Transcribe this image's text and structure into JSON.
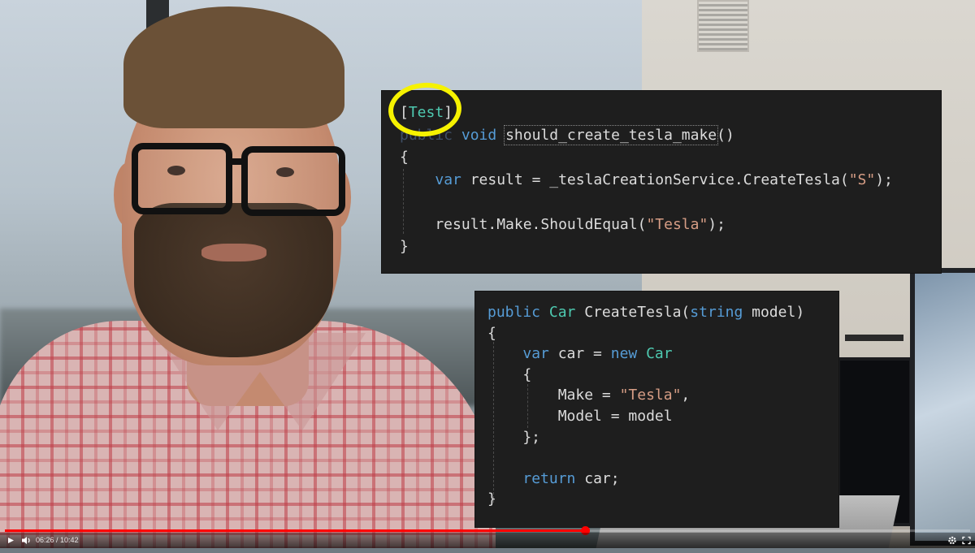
{
  "player": {
    "time_current": "06:26",
    "time_separator": " / ",
    "time_total": "10:42",
    "progress_fraction": 0.601,
    "accent_color": "#ff0000",
    "icons": {
      "play": "play-icon",
      "volume": "volume-icon",
      "settings": "gear-icon",
      "fullscreen": "fullscreen-icon"
    }
  },
  "code_top": {
    "lines": [
      {
        "segments": [
          {
            "t": "[",
            "c": "pl"
          },
          {
            "t": "Test",
            "c": "ty"
          },
          {
            "t": "]",
            "c": "pl"
          }
        ]
      },
      {
        "segments": [
          {
            "t": "public",
            "c": "fade"
          },
          {
            "t": " void ",
            "c": "kw"
          },
          {
            "t": "should_create_tesla_make",
            "c": "pl squiggle"
          },
          {
            "t": "()",
            "c": "pl"
          }
        ]
      },
      {
        "segments": [
          {
            "t": "{",
            "c": "pl"
          }
        ]
      },
      {
        "segments": [
          {
            "t": "    ",
            "c": "pl"
          },
          {
            "t": "var",
            "c": "kw"
          },
          {
            "t": " result = _teslaCreationService.CreateTesla(",
            "c": "pl"
          },
          {
            "t": "\"S\"",
            "c": "str"
          },
          {
            "t": ");",
            "c": "pl"
          }
        ]
      },
      {
        "segments": [
          {
            "t": "",
            "c": "pl"
          }
        ]
      },
      {
        "segments": [
          {
            "t": "    result.Make.ShouldEqual(",
            "c": "pl"
          },
          {
            "t": "\"Tesla\"",
            "c": "str"
          },
          {
            "t": ");",
            "c": "pl"
          }
        ]
      },
      {
        "segments": [
          {
            "t": "}",
            "c": "pl"
          }
        ]
      }
    ]
  },
  "code_bottom": {
    "lines": [
      {
        "segments": [
          {
            "t": "public ",
            "c": "kw"
          },
          {
            "t": "Car",
            "c": "ty"
          },
          {
            "t": " CreateTesla(",
            "c": "pl"
          },
          {
            "t": "string",
            "c": "kw"
          },
          {
            "t": " model)",
            "c": "pl"
          }
        ]
      },
      {
        "segments": [
          {
            "t": "{",
            "c": "pl"
          }
        ]
      },
      {
        "segments": [
          {
            "t": "    ",
            "c": "pl"
          },
          {
            "t": "var",
            "c": "kw"
          },
          {
            "t": " car = ",
            "c": "pl"
          },
          {
            "t": "new ",
            "c": "kw"
          },
          {
            "t": "Car",
            "c": "ty"
          }
        ]
      },
      {
        "segments": [
          {
            "t": "    {",
            "c": "pl"
          }
        ]
      },
      {
        "segments": [
          {
            "t": "        Make = ",
            "c": "pl"
          },
          {
            "t": "\"Tesla\"",
            "c": "str"
          },
          {
            "t": ",",
            "c": "pl"
          }
        ]
      },
      {
        "segments": [
          {
            "t": "        Model = model",
            "c": "pl"
          }
        ]
      },
      {
        "segments": [
          {
            "t": "    };",
            "c": "pl"
          }
        ]
      },
      {
        "segments": [
          {
            "t": "",
            "c": "pl"
          }
        ]
      },
      {
        "segments": [
          {
            "t": "    ",
            "c": "pl"
          },
          {
            "t": "return",
            "c": "kw"
          },
          {
            "t": " car;",
            "c": "pl"
          }
        ]
      },
      {
        "segments": [
          {
            "t": "}",
            "c": "pl"
          }
        ]
      }
    ]
  },
  "colors": {
    "keyword": "#569cd6",
    "type": "#4ec9b0",
    "string": "#d69d85",
    "annotation_ring": "#f6f200",
    "editor_bg": "#1e1e1e"
  }
}
